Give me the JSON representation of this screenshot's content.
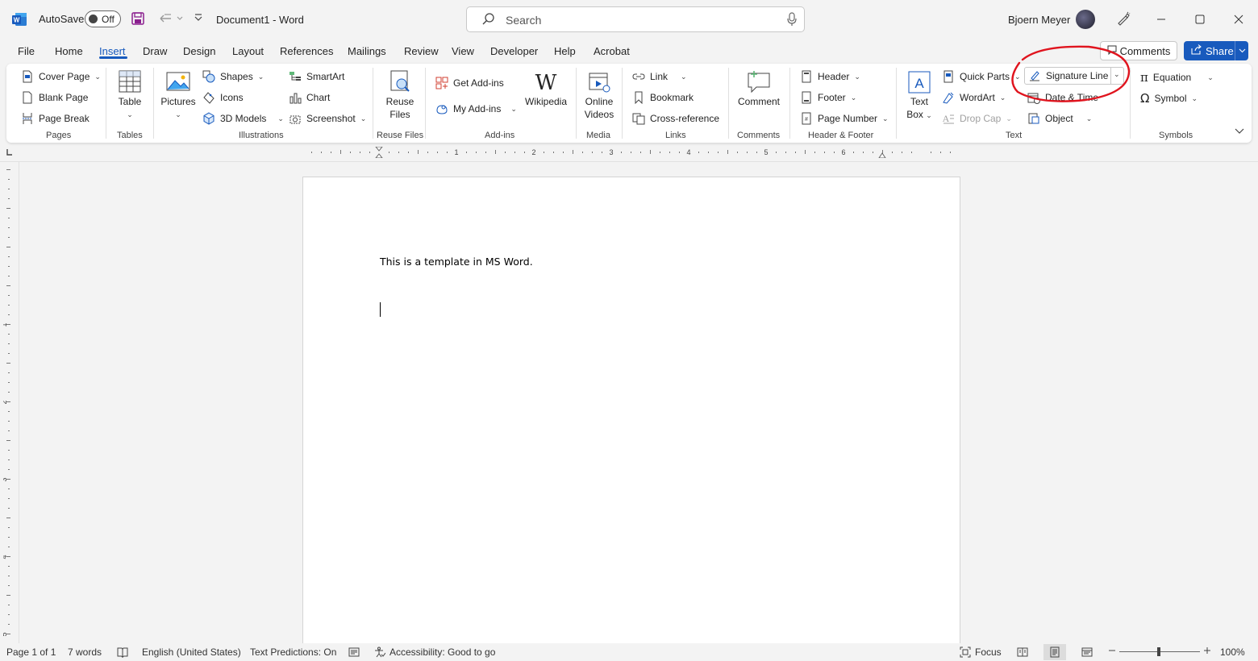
{
  "titlebar": {
    "autosave_label": "AutoSave",
    "autosave_state": "Off",
    "doc_title": "Document1  -  Word",
    "search_placeholder": "Search",
    "user_name": "Bjoern  Meyer"
  },
  "menu": {
    "tabs": [
      "File",
      "Home",
      "Insert",
      "Draw",
      "Design",
      "Layout",
      "References",
      "Mailings",
      "Review",
      "View",
      "Developer",
      "Help",
      "Acrobat"
    ],
    "active_tab": "Insert",
    "comments_label": "Comments",
    "share_label": "Share"
  },
  "ribbon": {
    "pages": {
      "cover_page": "Cover Page",
      "blank_page": "Blank Page",
      "page_break": "Page Break",
      "label": "Pages"
    },
    "tables": {
      "table": "Table",
      "label": "Tables"
    },
    "illustrations": {
      "pictures": "Pictures",
      "shapes": "Shapes",
      "icons": "Icons",
      "models": "3D Models",
      "smartart": "SmartArt",
      "chart": "Chart",
      "screenshot": "Screenshot",
      "label": "Illustrations"
    },
    "reuse": {
      "line1": "Reuse",
      "line2": "Files",
      "label": "Reuse Files"
    },
    "addins": {
      "get": "Get Add-ins",
      "my": "My Add-ins",
      "wikipedia": "Wikipedia",
      "label": "Add-ins"
    },
    "media": {
      "line1": "Online",
      "line2": "Videos",
      "label": "Media"
    },
    "links": {
      "link": "Link",
      "bookmark": "Bookmark",
      "crossref": "Cross-reference",
      "label": "Links"
    },
    "comments": {
      "comment": "Comment",
      "label": "Comments"
    },
    "headerfooter": {
      "header": "Header",
      "footer": "Footer",
      "page_number": "Page Number",
      "label": "Header & Footer"
    },
    "text": {
      "textbox1": "Text",
      "textbox2": "Box",
      "quick_parts": "Quick Parts",
      "wordart": "WordArt",
      "drop_cap": "Drop Cap",
      "signature_line": "Signature Line",
      "date_time": "Date & Time",
      "object": "Object",
      "label": "Text"
    },
    "symbols": {
      "equation": "Equation",
      "symbol": "Symbol",
      "label": "Symbols"
    }
  },
  "ruler": {
    "numbers": [
      "1",
      "2",
      "3",
      "4",
      "5",
      "6"
    ],
    "vnumbers": [
      "1",
      "2",
      "3",
      "4",
      "5"
    ]
  },
  "document": {
    "text": "This is a template in MS Word."
  },
  "status": {
    "page": "Page 1 of 1",
    "words": "7 words",
    "language": "English (United States)",
    "predictions": "Text Predictions: On",
    "accessibility": "Accessibility: Good to go",
    "focus": "Focus",
    "zoom": "100%"
  },
  "colors": {
    "accent": "#185abd",
    "annotation": "#e0141e"
  }
}
